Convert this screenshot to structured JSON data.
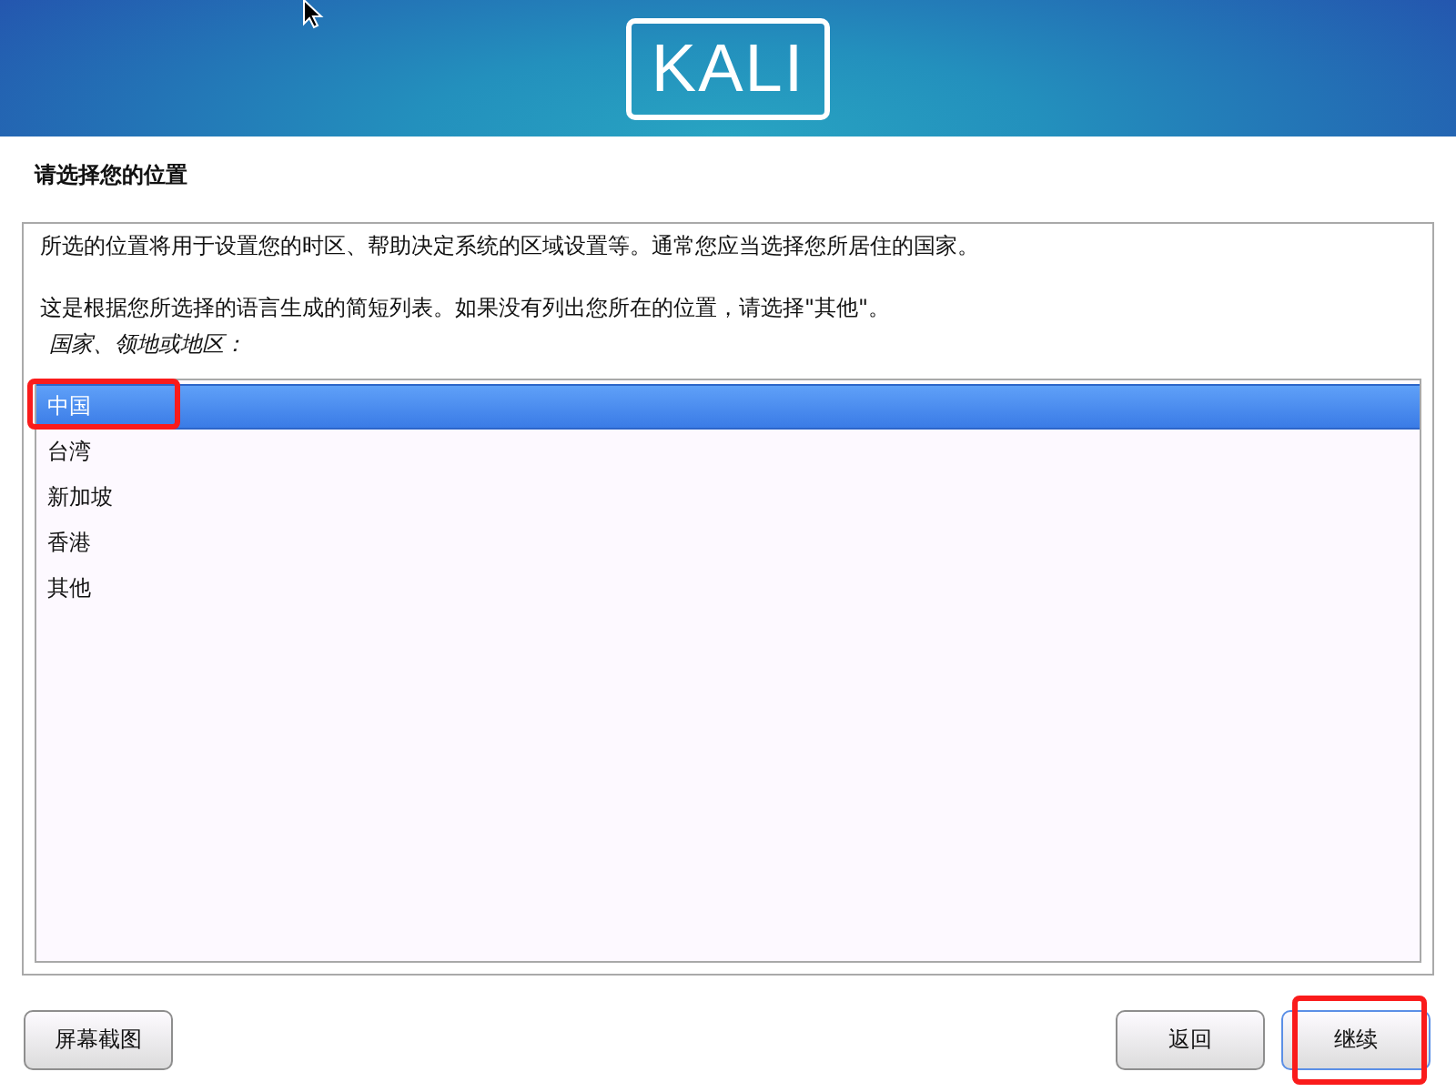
{
  "header": {
    "logo": "KALI"
  },
  "page_title": "请选择您的位置",
  "panel": {
    "paragraphs": [
      "所选的位置将用于设置您的时区、帮助决定系统的区域设置等。通常您应当选择您所居住的国家。",
      "这是根据您所选择的语言生成的简短列表。如果没有列出您所在的位置，请选择\"其他\"。"
    ],
    "list_label": "国家、领地或地区：",
    "options": [
      {
        "label": "中国",
        "selected": true,
        "highlighted": true
      },
      {
        "label": "台湾",
        "selected": false,
        "highlighted": false
      },
      {
        "label": "新加坡",
        "selected": false,
        "highlighted": false
      },
      {
        "label": "香港",
        "selected": false,
        "highlighted": false
      },
      {
        "label": "其他",
        "selected": false,
        "highlighted": false
      }
    ]
  },
  "buttons": {
    "left": [
      {
        "label": "屏幕截图",
        "focused": false,
        "highlighted": false
      }
    ],
    "right": [
      {
        "label": "返回",
        "focused": false,
        "highlighted": false
      },
      {
        "label": "继续",
        "focused": true,
        "highlighted": true
      }
    ]
  }
}
